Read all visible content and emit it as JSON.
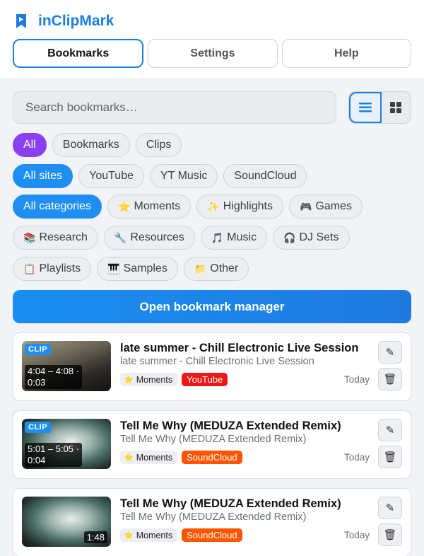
{
  "app": {
    "name": "inClipMark",
    "logo_icon": "bookmark-icon",
    "accent": "#1a7fe0"
  },
  "tabs": [
    {
      "label": "Bookmarks",
      "active": true
    },
    {
      "label": "Settings",
      "active": false
    },
    {
      "label": "Help",
      "active": false
    }
  ],
  "search": {
    "placeholder": "Search bookmarks…",
    "value": ""
  },
  "view_toggle": {
    "selected": "list",
    "options": [
      "list-view-icon",
      "grid-view-icon"
    ]
  },
  "filters": {
    "type": [
      {
        "label": "All",
        "selected": true,
        "color": "#8a3ff2"
      },
      {
        "label": "Bookmarks",
        "selected": false
      },
      {
        "label": "Clips",
        "selected": false
      }
    ],
    "sites": [
      {
        "label": "All sites",
        "selected": true,
        "color": "#1e8ff0"
      },
      {
        "label": "YouTube",
        "selected": false
      },
      {
        "label": "YT Music",
        "selected": false
      },
      {
        "label": "SoundCloud",
        "selected": false
      }
    ],
    "categories_row1": [
      {
        "icon": "",
        "label": "All categories",
        "selected": true
      },
      {
        "icon": "⭐",
        "label": "Moments",
        "selected": false
      },
      {
        "icon": "✨",
        "label": "Highlights",
        "selected": false
      },
      {
        "icon": "🎮",
        "label": "Games",
        "selected": false
      }
    ],
    "categories_row2": [
      {
        "icon": "📚",
        "label": "Research"
      },
      {
        "icon": "🔧",
        "label": "Resources"
      },
      {
        "icon": "🎵",
        "label": "Music"
      },
      {
        "icon": "🎧",
        "label": "DJ Sets"
      }
    ],
    "categories_row3": [
      {
        "icon": "📋",
        "label": "Playlists"
      },
      {
        "icon": "🎹",
        "label": "Samples"
      },
      {
        "icon": "📁",
        "label": "Other"
      }
    ]
  },
  "open_manager": {
    "label": "Open bookmark manager"
  },
  "bookmarks": [
    {
      "badge": "CLIP",
      "time_range": "4:04 – 4:08 ·",
      "duration": "0:03",
      "title": "late summer - Chill Electronic Live Session",
      "subtitle": "late summer - Chill Electronic Live Session",
      "category_icon": "⭐",
      "category": "Moments",
      "site": "YouTube",
      "site_color": "#ee1616",
      "date": "Today"
    },
    {
      "badge": "CLIP",
      "time_range": "5:01 – 5:05 ·",
      "duration": "0:04",
      "title": "Tell Me Why (MEDUZA Extended Remix)",
      "subtitle": "Tell Me Why (MEDUZA Extended Remix)",
      "category_icon": "⭐",
      "category": "Moments",
      "site": "SoundCloud",
      "site_color": "#ff5500",
      "date": "Today"
    },
    {
      "duration": "1:48",
      "title": "Tell Me Why (MEDUZA Extended Remix)",
      "subtitle": "Tell Me Why (MEDUZA Extended Remix)",
      "category_icon": "⭐",
      "category": "Moments",
      "site": "SoundCloud",
      "site_color": "#ff5500",
      "date": "Today"
    }
  ],
  "actions": {
    "edit_icon": "✎",
    "delete_icon": "🗑"
  }
}
